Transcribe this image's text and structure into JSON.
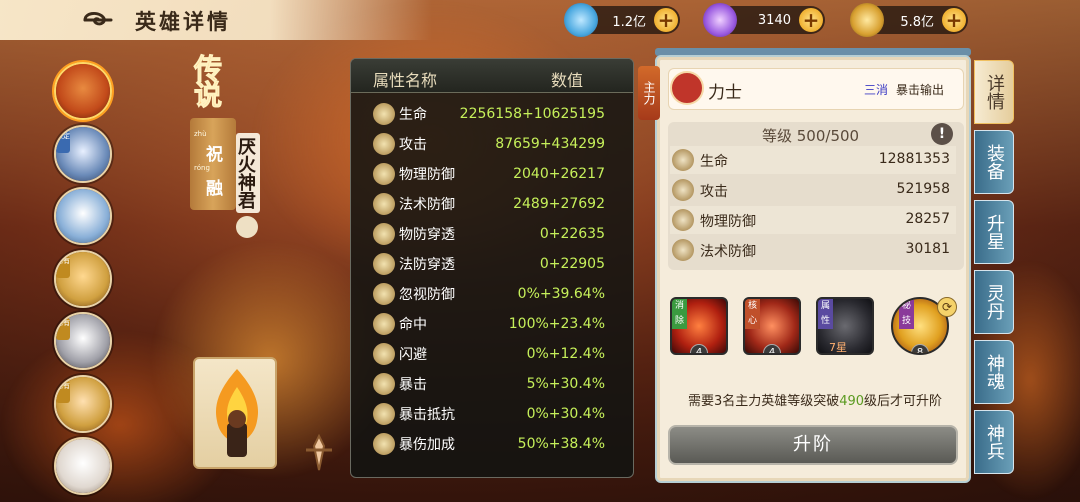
{
  "header": {
    "title": "英雄详情"
  },
  "currencies": [
    {
      "icon": "diamond-gem-icon",
      "value": "1.2亿",
      "color": "#4aa8e0"
    },
    {
      "icon": "purple-orb-icon",
      "value": "3140",
      "color": "#9a5ae0"
    },
    {
      "icon": "gold-coin-icon",
      "value": "5.8亿",
      "color": "#d8a030"
    }
  ],
  "roster": [
    {
      "tag": "",
      "color": "#c24a1a",
      "active": true
    },
    {
      "tag": "限定",
      "color": "#6a8ab8",
      "active": false
    },
    {
      "tag": "",
      "color": "#8ab0d8",
      "active": false
    },
    {
      "tag": "稀有",
      "color": "#d0a040",
      "active": false
    },
    {
      "tag": "稀有",
      "color": "#a0a0a8",
      "active": false
    },
    {
      "tag": "稀有",
      "color": "#d0a040",
      "active": false
    },
    {
      "tag": "",
      "color": "#e0d8d0",
      "active": false
    }
  ],
  "hero": {
    "rarity": "传说",
    "name_chars": [
      {
        "pinyin": "zhù",
        "hz": "祝"
      },
      {
        "pinyin": "róng",
        "hz": "融"
      }
    ],
    "title": "厌火神君"
  },
  "attributes": {
    "col_name": "属性名称",
    "col_value": "数值",
    "rows": [
      {
        "icon": "life-icon",
        "label": "生命",
        "value": "2256158+10625195"
      },
      {
        "icon": "attack-icon",
        "label": "攻击",
        "value": "87659+434299"
      },
      {
        "icon": "physical-defense-icon",
        "label": "物理防御",
        "value": "2040+26217"
      },
      {
        "icon": "magic-defense-icon",
        "label": "法术防御",
        "value": "2489+27692"
      },
      {
        "icon": "physical-pierce-icon",
        "label": "物防穿透",
        "value": "0+22635"
      },
      {
        "icon": "magic-pierce-icon",
        "label": "法防穿透",
        "value": "0+22905"
      },
      {
        "icon": "ignore-defense-icon",
        "label": "忽视防御",
        "value": "0%+39.64%"
      },
      {
        "icon": "hit-icon",
        "label": "命中",
        "value": "100%+23.4%"
      },
      {
        "icon": "dodge-icon",
        "label": "闪避",
        "value": "0%+12.4%"
      },
      {
        "icon": "crit-icon",
        "label": "暴击",
        "value": "5%+30.4%"
      },
      {
        "icon": "crit-resist-icon",
        "label": "暴击抵抗",
        "value": "0%+30.4%"
      },
      {
        "icon": "crit-damage-icon",
        "label": "暴伤加成",
        "value": "50%+38.4%"
      }
    ]
  },
  "detail": {
    "side_label": "主力",
    "class_name": "力士",
    "class_tags": [
      "三消",
      "暴击输出"
    ],
    "level": "等级 500/500",
    "stats": [
      {
        "icon": "life-icon",
        "label": "生命",
        "value": "12881353"
      },
      {
        "icon": "attack-icon",
        "label": "攻击",
        "value": "521958"
      },
      {
        "icon": "physical-defense-icon",
        "label": "物理防御",
        "value": "28257"
      },
      {
        "icon": "magic-defense-icon",
        "label": "法术防御",
        "value": "30181"
      }
    ],
    "skills": [
      {
        "badge": "消除",
        "badge_color": "#3a9a40",
        "level": "4"
      },
      {
        "badge": "核心",
        "badge_color": "#c0502a",
        "level": "4"
      },
      {
        "badge": "属性",
        "badge_color": "#5a4aa0",
        "level": "7星"
      },
      {
        "badge": "秘技",
        "badge_color": "#8a3a9a",
        "level": "8"
      }
    ],
    "breakthrough_pre": "需要3名主力英雄等级突破",
    "breakthrough_num": "490",
    "breakthrough_post": "级后才可升阶",
    "upgrade_label": "升阶"
  },
  "side_tabs": [
    "详情",
    "装备",
    "升星",
    "灵丹",
    "神魂",
    "神兵"
  ]
}
